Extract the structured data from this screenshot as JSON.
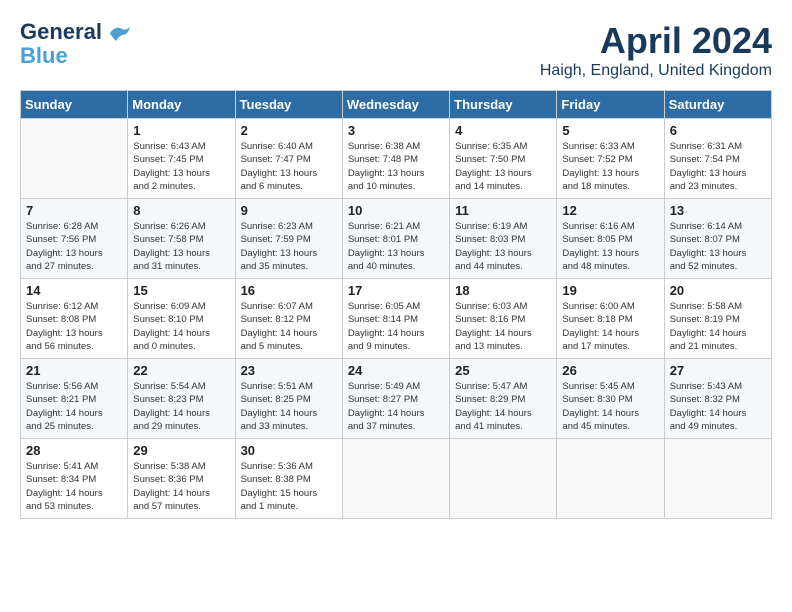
{
  "header": {
    "logo_line1": "General",
    "logo_line2": "Blue",
    "month_title": "April 2024",
    "location": "Haigh, England, United Kingdom"
  },
  "weekdays": [
    "Sunday",
    "Monday",
    "Tuesday",
    "Wednesday",
    "Thursday",
    "Friday",
    "Saturday"
  ],
  "weeks": [
    [
      {
        "day": "",
        "info": ""
      },
      {
        "day": "1",
        "info": "Sunrise: 6:43 AM\nSunset: 7:45 PM\nDaylight: 13 hours\nand 2 minutes."
      },
      {
        "day": "2",
        "info": "Sunrise: 6:40 AM\nSunset: 7:47 PM\nDaylight: 13 hours\nand 6 minutes."
      },
      {
        "day": "3",
        "info": "Sunrise: 6:38 AM\nSunset: 7:48 PM\nDaylight: 13 hours\nand 10 minutes."
      },
      {
        "day": "4",
        "info": "Sunrise: 6:35 AM\nSunset: 7:50 PM\nDaylight: 13 hours\nand 14 minutes."
      },
      {
        "day": "5",
        "info": "Sunrise: 6:33 AM\nSunset: 7:52 PM\nDaylight: 13 hours\nand 18 minutes."
      },
      {
        "day": "6",
        "info": "Sunrise: 6:31 AM\nSunset: 7:54 PM\nDaylight: 13 hours\nand 23 minutes."
      }
    ],
    [
      {
        "day": "7",
        "info": "Sunrise: 6:28 AM\nSunset: 7:56 PM\nDaylight: 13 hours\nand 27 minutes."
      },
      {
        "day": "8",
        "info": "Sunrise: 6:26 AM\nSunset: 7:58 PM\nDaylight: 13 hours\nand 31 minutes."
      },
      {
        "day": "9",
        "info": "Sunrise: 6:23 AM\nSunset: 7:59 PM\nDaylight: 13 hours\nand 35 minutes."
      },
      {
        "day": "10",
        "info": "Sunrise: 6:21 AM\nSunset: 8:01 PM\nDaylight: 13 hours\nand 40 minutes."
      },
      {
        "day": "11",
        "info": "Sunrise: 6:19 AM\nSunset: 8:03 PM\nDaylight: 13 hours\nand 44 minutes."
      },
      {
        "day": "12",
        "info": "Sunrise: 6:16 AM\nSunset: 8:05 PM\nDaylight: 13 hours\nand 48 minutes."
      },
      {
        "day": "13",
        "info": "Sunrise: 6:14 AM\nSunset: 8:07 PM\nDaylight: 13 hours\nand 52 minutes."
      }
    ],
    [
      {
        "day": "14",
        "info": "Sunrise: 6:12 AM\nSunset: 8:08 PM\nDaylight: 13 hours\nand 56 minutes."
      },
      {
        "day": "15",
        "info": "Sunrise: 6:09 AM\nSunset: 8:10 PM\nDaylight: 14 hours\nand 0 minutes."
      },
      {
        "day": "16",
        "info": "Sunrise: 6:07 AM\nSunset: 8:12 PM\nDaylight: 14 hours\nand 5 minutes."
      },
      {
        "day": "17",
        "info": "Sunrise: 6:05 AM\nSunset: 8:14 PM\nDaylight: 14 hours\nand 9 minutes."
      },
      {
        "day": "18",
        "info": "Sunrise: 6:03 AM\nSunset: 8:16 PM\nDaylight: 14 hours\nand 13 minutes."
      },
      {
        "day": "19",
        "info": "Sunrise: 6:00 AM\nSunset: 8:18 PM\nDaylight: 14 hours\nand 17 minutes."
      },
      {
        "day": "20",
        "info": "Sunrise: 5:58 AM\nSunset: 8:19 PM\nDaylight: 14 hours\nand 21 minutes."
      }
    ],
    [
      {
        "day": "21",
        "info": "Sunrise: 5:56 AM\nSunset: 8:21 PM\nDaylight: 14 hours\nand 25 minutes."
      },
      {
        "day": "22",
        "info": "Sunrise: 5:54 AM\nSunset: 8:23 PM\nDaylight: 14 hours\nand 29 minutes."
      },
      {
        "day": "23",
        "info": "Sunrise: 5:51 AM\nSunset: 8:25 PM\nDaylight: 14 hours\nand 33 minutes."
      },
      {
        "day": "24",
        "info": "Sunrise: 5:49 AM\nSunset: 8:27 PM\nDaylight: 14 hours\nand 37 minutes."
      },
      {
        "day": "25",
        "info": "Sunrise: 5:47 AM\nSunset: 8:29 PM\nDaylight: 14 hours\nand 41 minutes."
      },
      {
        "day": "26",
        "info": "Sunrise: 5:45 AM\nSunset: 8:30 PM\nDaylight: 14 hours\nand 45 minutes."
      },
      {
        "day": "27",
        "info": "Sunrise: 5:43 AM\nSunset: 8:32 PM\nDaylight: 14 hours\nand 49 minutes."
      }
    ],
    [
      {
        "day": "28",
        "info": "Sunrise: 5:41 AM\nSunset: 8:34 PM\nDaylight: 14 hours\nand 53 minutes."
      },
      {
        "day": "29",
        "info": "Sunrise: 5:38 AM\nSunset: 8:36 PM\nDaylight: 14 hours\nand 57 minutes."
      },
      {
        "day": "30",
        "info": "Sunrise: 5:36 AM\nSunset: 8:38 PM\nDaylight: 15 hours\nand 1 minute."
      },
      {
        "day": "",
        "info": ""
      },
      {
        "day": "",
        "info": ""
      },
      {
        "day": "",
        "info": ""
      },
      {
        "day": "",
        "info": ""
      }
    ]
  ]
}
